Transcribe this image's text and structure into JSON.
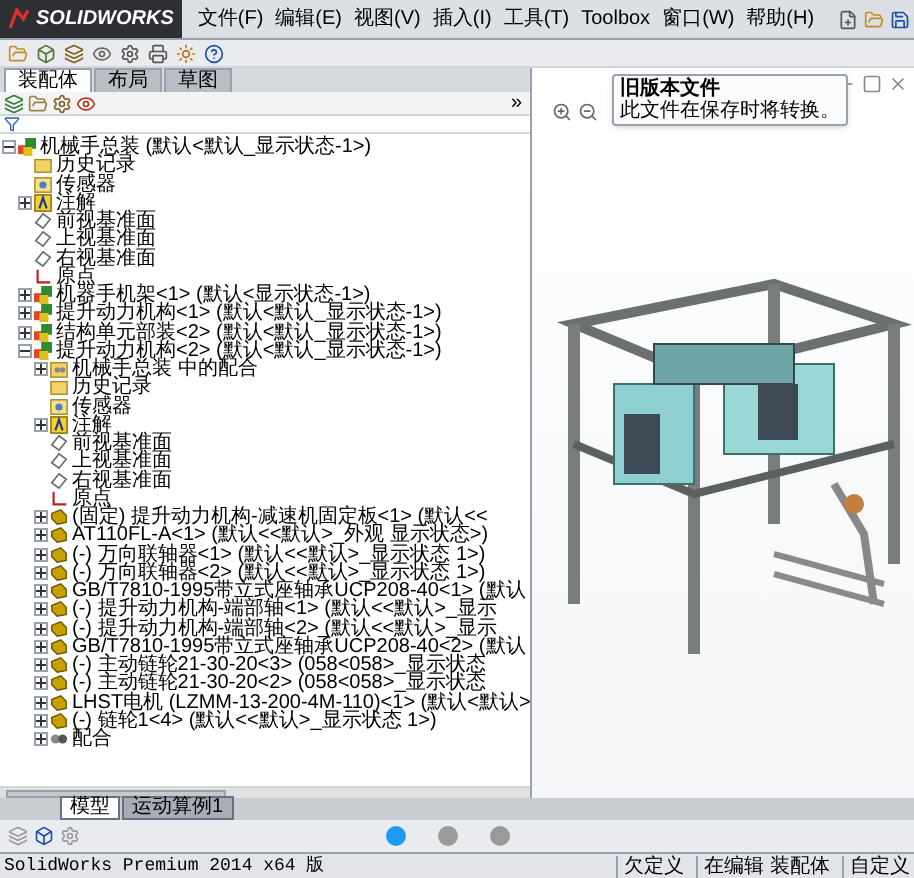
{
  "app": {
    "logo": "SOLIDWORKS",
    "menu": [
      "文件(F)",
      "编辑(E)",
      "视图(V)",
      "插入(I)",
      "工具(T)",
      "Toolbox",
      "窗口(W)",
      "帮助(H)"
    ]
  },
  "panel_tabs": [
    {
      "label": "装配体",
      "selected": true
    },
    {
      "label": "布局",
      "selected": false
    },
    {
      "label": "草图",
      "selected": false
    }
  ],
  "panel_expand": "»",
  "tree": [
    {
      "kind": "assembly",
      "label": "机械手总装  (默认<默认_显示状态-1>)",
      "expanded": true,
      "children": [
        {
          "kind": "history",
          "label": "历史记录"
        },
        {
          "kind": "sensor",
          "label": "传感器"
        },
        {
          "kind": "annotation",
          "label": "注解",
          "expanded": false
        },
        {
          "kind": "plane",
          "label": "前视基准面"
        },
        {
          "kind": "plane",
          "label": "上视基准面"
        },
        {
          "kind": "plane",
          "label": "右视基准面"
        },
        {
          "kind": "origin",
          "label": "原点"
        },
        {
          "kind": "assembly",
          "label": "机器手机架<1>  (默认<显示状态-1>)",
          "expanded": false
        },
        {
          "kind": "assembly",
          "label": "提升动力机构<1>  (默认<默认_显示状态-1>)",
          "expanded": false
        },
        {
          "kind": "assembly",
          "label": "结构单元部装<2>  (默认<默认_显示状态-1>)",
          "expanded": false
        },
        {
          "kind": "assembly",
          "label": "提升动力机构<2>  (默认<默认_显示状态-1>)",
          "expanded": true,
          "children": [
            {
              "kind": "mates",
              "label": "机械手总装 中的配合",
              "expanded": false
            },
            {
              "kind": "history",
              "label": "历史记录"
            },
            {
              "kind": "sensor",
              "label": "传感器"
            },
            {
              "kind": "annotation",
              "label": "注解",
              "expanded": false
            },
            {
              "kind": "plane",
              "label": "前视基准面"
            },
            {
              "kind": "plane",
              "label": "上视基准面"
            },
            {
              "kind": "plane",
              "label": "右视基准面"
            },
            {
              "kind": "origin",
              "label": "原点"
            },
            {
              "kind": "part",
              "label": "(固定) 提升动力机构-减速机固定板<1> (默认<<",
              "expanded": false
            },
            {
              "kind": "part",
              "label": "AT110FL-A<1> (默认<<默认>_外观 显示状态>)",
              "expanded": false
            },
            {
              "kind": "part",
              "label": "(-) 万向联轴器<1> (默认<<默认>_显示状态 1>)",
              "expanded": false
            },
            {
              "kind": "part",
              "label": "(-) 万向联轴器<2> (默认<<默认>_显示状态 1>)",
              "expanded": false
            },
            {
              "kind": "part",
              "label": "GB/T7810-1995带立式座轴承UCP208-40<1> (默认",
              "expanded": false
            },
            {
              "kind": "part",
              "label": "(-) 提升动力机构-端部轴<1> (默认<<默认>_显示",
              "expanded": false
            },
            {
              "kind": "part",
              "label": "(-) 提升动力机构-端部轴<2> (默认<<默认>_显示",
              "expanded": false
            },
            {
              "kind": "part",
              "label": "GB/T7810-1995带立式座轴承UCP208-40<2> (默认",
              "expanded": false
            },
            {
              "kind": "part",
              "label": "(-) 主动链轮21-30-20<3> (058<058>_显示状态",
              "expanded": false
            },
            {
              "kind": "part",
              "label": "(-) 主动链轮21-30-20<2> (058<058>_显示状态",
              "expanded": false
            },
            {
              "kind": "part",
              "label": "LHST电机 (LZMM-13-200-4M-110)<1> (默认<默认>",
              "expanded": false
            },
            {
              "kind": "part",
              "label": "(-) 链轮1<4> (默认<<默认>_显示状态 1>)",
              "expanded": false
            },
            {
              "kind": "matefolder",
              "label": "配合",
              "expanded": false
            }
          ]
        }
      ]
    }
  ],
  "tooltip": {
    "title": "旧版本文件",
    "text": "此文件在保存时将转换。"
  },
  "bottom_tabs": [
    {
      "label": "模型",
      "selected": true
    },
    {
      "label": "运动算例1",
      "selected": false
    }
  ],
  "page_dots": [
    {
      "selected": true
    },
    {
      "selected": false
    },
    {
      "selected": false
    }
  ],
  "status_bar": {
    "product": "SolidWorks Premium 2014 x64 版",
    "fields": [
      "欠定义",
      "在编辑 装配体",
      "自定义"
    ]
  }
}
